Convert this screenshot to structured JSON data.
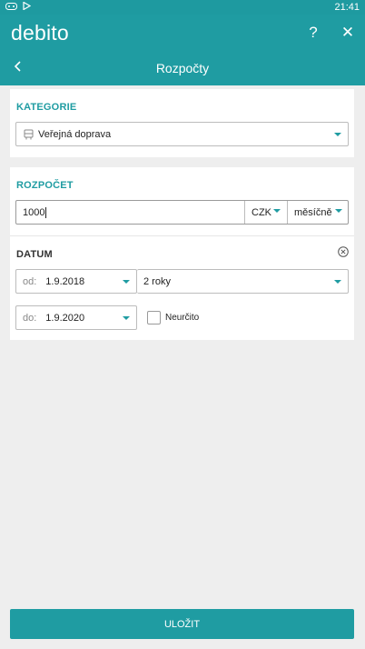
{
  "status_bar": {
    "time": "21:41",
    "icons": [
      "gamepad-icon",
      "play-store-icon"
    ]
  },
  "app_bar": {
    "brand": "debito",
    "help_label": "?",
    "close_label": "✕"
  },
  "sub_bar": {
    "title": "Rozpočty"
  },
  "category": {
    "label": "KATEGORIE",
    "selected": "Veřejná doprava",
    "icon": "bus-icon"
  },
  "budget": {
    "label": "ROZPOČET",
    "amount": "1000",
    "currency": "CZK",
    "period": "měsíčně"
  },
  "date": {
    "label": "DATUM",
    "from_prefix": "od:",
    "from_value": "1.9.2018",
    "duration": "2 roky",
    "to_prefix": "do:",
    "to_value": "1.9.2020",
    "indefinite_label": "Neurčito",
    "indefinite_checked": false
  },
  "save_label": "ULOŽIT",
  "colors": {
    "accent": "#1f9ca2",
    "background": "#eeeeee"
  }
}
